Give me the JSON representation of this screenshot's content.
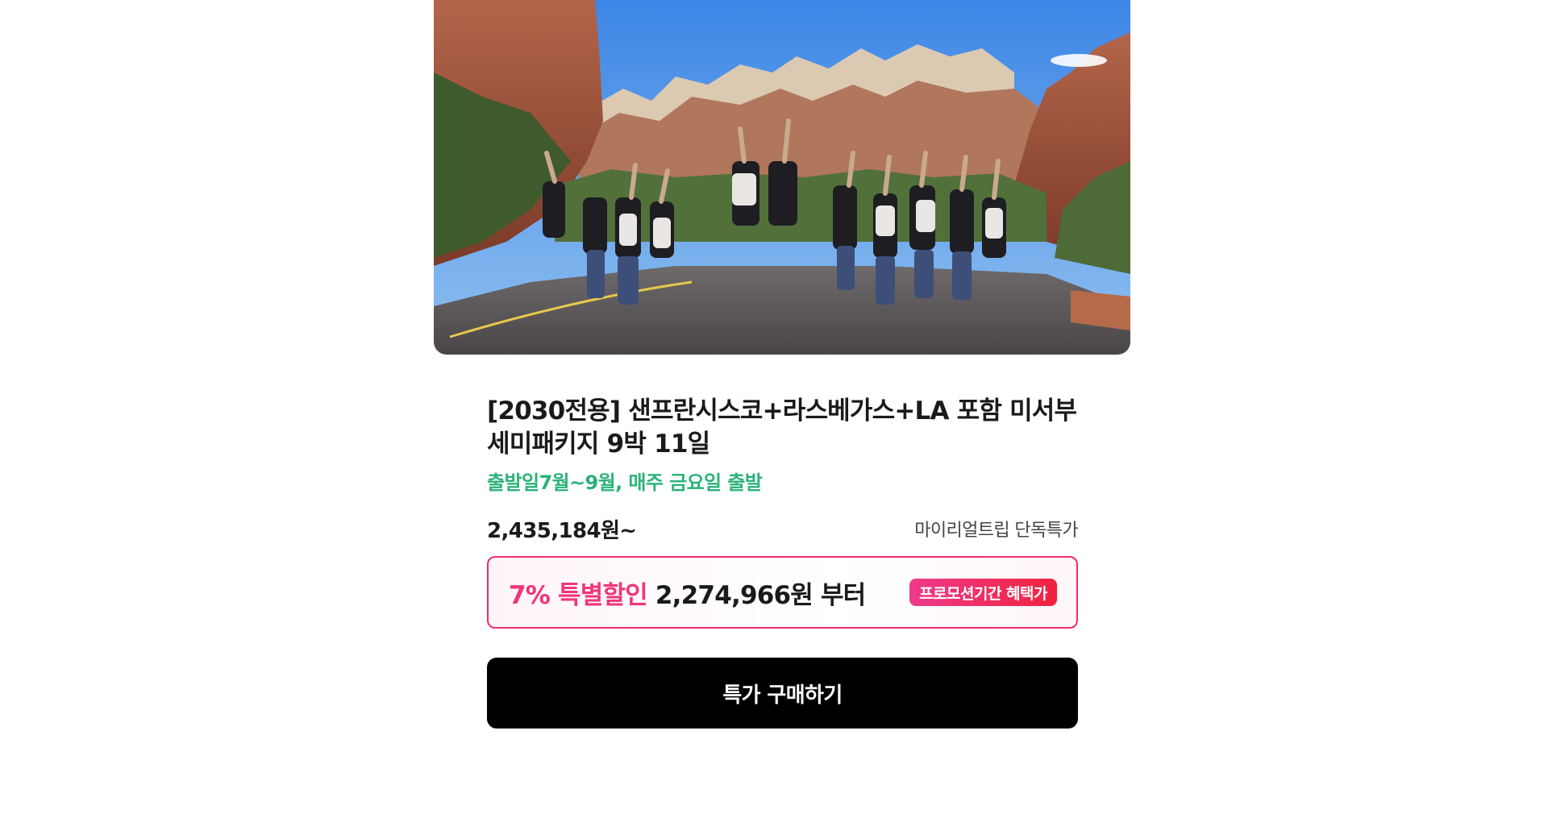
{
  "product": {
    "image_alt": "Group of travelers jumping with raised arms on a road in front of red canyon cliffs under a blue sky",
    "title_line1": "[2030전용] 샌프란시스코+라스베가스+LA 포함 미서부",
    "title_line2": "세미패키지 9박 11일",
    "schedule": "출발일7월~9월, 매주 금요일 출발",
    "price": "2,435,184원~",
    "exclusive_label": "마이리얼트립 단독특가"
  },
  "promo": {
    "discount": "7% 특별할인",
    "price": "2,274,966원 부터",
    "badge": "프로모션기간 혜택가"
  },
  "cta": {
    "label": "특가 구매하기"
  },
  "colors": {
    "schedule_green": "#2bb27a",
    "promo_pink": "#f0357a",
    "promo_border": "#ef2c6f",
    "badge_gradient_start": "#ef3a8c",
    "badge_gradient_end": "#f0223e",
    "button_bg": "#000000"
  }
}
